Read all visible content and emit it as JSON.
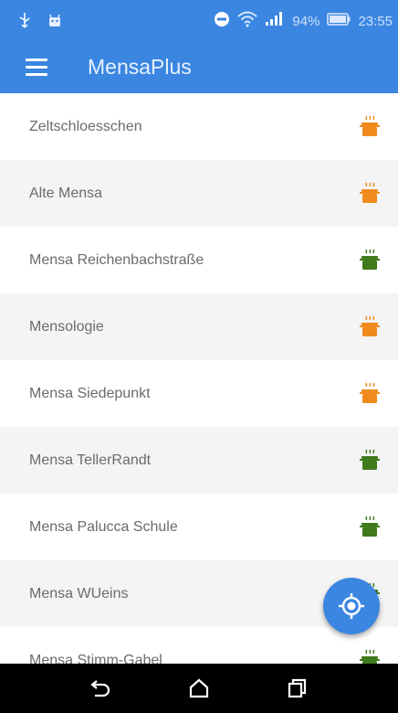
{
  "status_bar": {
    "battery_percent": "94%",
    "time": "23:55",
    "icons": [
      "usb-icon",
      "android-icon",
      "do-not-disturb-icon",
      "wifi-icon",
      "signal-icon",
      "battery-icon"
    ]
  },
  "app_bar": {
    "title": "MensaPlus",
    "menu_icon": "hamburger-menu-icon",
    "background_color": "#3a86e0"
  },
  "mensa_list": [
    {
      "name": "Zeltschloesschen",
      "status_icon": "pot-icon",
      "status_color": "#f08a1c"
    },
    {
      "name": "Alte Mensa",
      "status_icon": "pot-icon",
      "status_color": "#f08a1c"
    },
    {
      "name": "Mensa Reichenbachstraße",
      "status_icon": "pot-icon",
      "status_color": "#3f7a1c"
    },
    {
      "name": "Mensologie",
      "status_icon": "pot-icon",
      "status_color": "#f08a1c"
    },
    {
      "name": "Mensa Siedepunkt",
      "status_icon": "pot-icon",
      "status_color": "#f08a1c"
    },
    {
      "name": "Mensa TellerRandt",
      "status_icon": "pot-icon",
      "status_color": "#3f7a1c"
    },
    {
      "name": "Mensa Palucca Schule",
      "status_icon": "pot-icon",
      "status_color": "#3f7a1c"
    },
    {
      "name": "Mensa WUeins",
      "status_icon": "pot-icon",
      "status_color": "#3f7a1c"
    },
    {
      "name": "Mensa Stimm-Gabel",
      "status_icon": "pot-icon",
      "status_color": "#3f7a1c"
    }
  ],
  "fab": {
    "icon": "gps-location-icon",
    "color": "#3a86e0"
  },
  "nav_bar": {
    "buttons": [
      "back-icon",
      "home-icon",
      "recents-icon"
    ]
  }
}
